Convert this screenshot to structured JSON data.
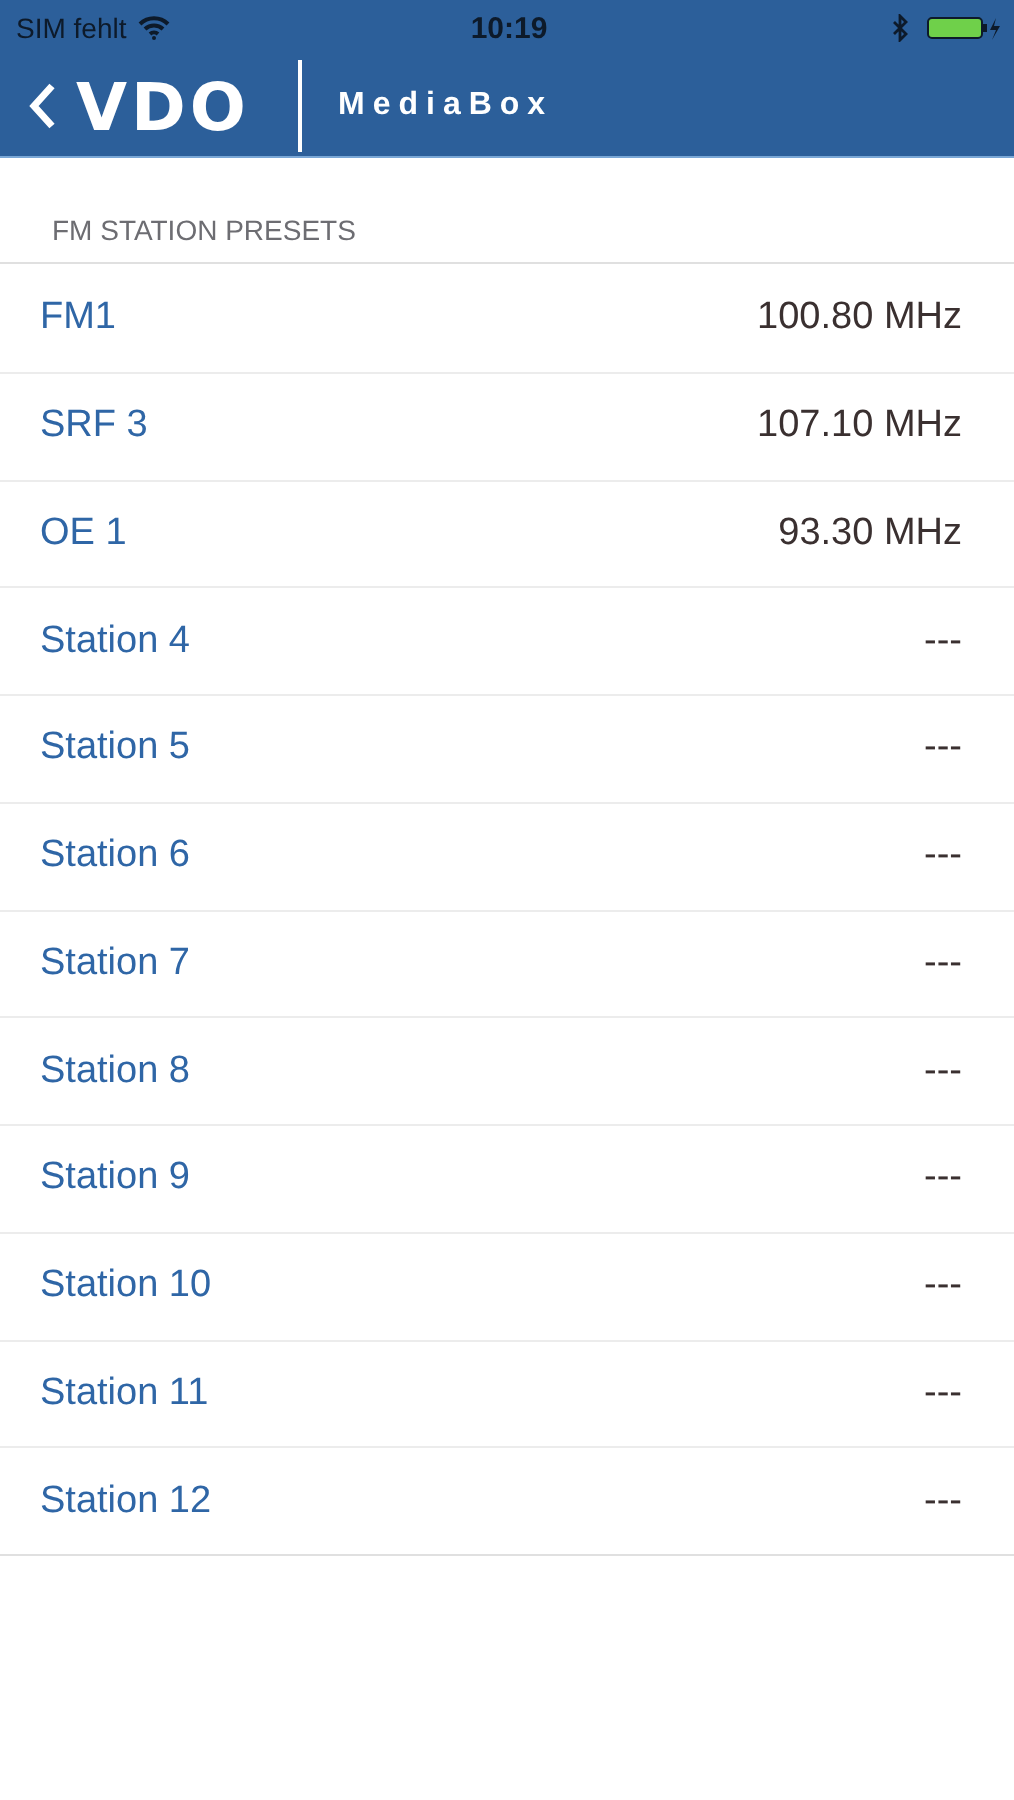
{
  "status_bar": {
    "carrier": "SIM fehlt",
    "time": "10:19"
  },
  "nav_bar": {
    "logo": "VDO",
    "title": "MediaBox"
  },
  "section": {
    "header": "FM STATION PRESETS",
    "rows": [
      {
        "name": "FM1",
        "frequency": "100.80 MHz"
      },
      {
        "name": "SRF 3",
        "frequency": "107.10 MHz"
      },
      {
        "name": "OE 1",
        "frequency": "93.30 MHz"
      },
      {
        "name": "Station 4",
        "frequency": "---"
      },
      {
        "name": "Station 5",
        "frequency": "---"
      },
      {
        "name": "Station 6",
        "frequency": "---"
      },
      {
        "name": "Station 7",
        "frequency": "---"
      },
      {
        "name": "Station 8",
        "frequency": "---"
      },
      {
        "name": "Station 9",
        "frequency": "---"
      },
      {
        "name": "Station 10",
        "frequency": "---"
      },
      {
        "name": "Station 11",
        "frequency": "---"
      },
      {
        "name": "Station 12",
        "frequency": "---"
      }
    ]
  }
}
